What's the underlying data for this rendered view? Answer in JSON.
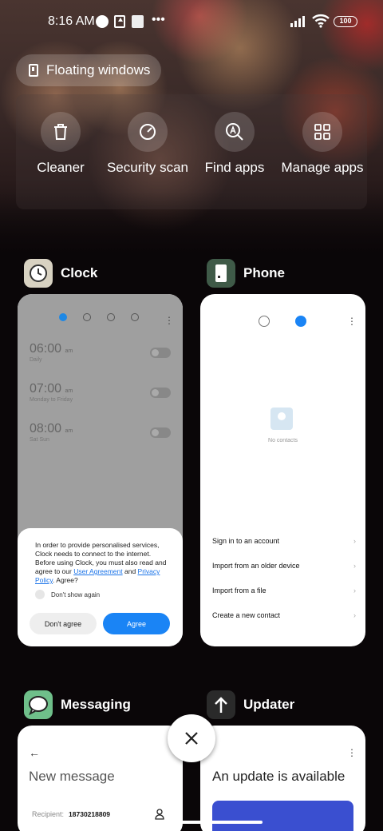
{
  "status_bar": {
    "time": "8:16 AM",
    "battery": "100"
  },
  "floating_windows": {
    "label": "Floating windows"
  },
  "quick_actions": [
    {
      "label": "Cleaner",
      "icon": "trash-icon"
    },
    {
      "label": "Security scan",
      "icon": "gauge-icon"
    },
    {
      "label": "Find apps",
      "icon": "search-apps-icon"
    },
    {
      "label": "Manage apps",
      "icon": "grid-icon"
    }
  ],
  "apps": {
    "clock": {
      "title": "Clock",
      "alarms": [
        {
          "time": "06:00",
          "suffix": "am",
          "sub": "Daily"
        },
        {
          "time": "07:00",
          "suffix": "am",
          "sub": "Monday to Friday"
        },
        {
          "time": "08:00",
          "suffix": "am",
          "sub": "Sat Sun"
        }
      ],
      "dialog": {
        "text_before": "In order to provide personalised services, Clock needs to connect to the internet. Before using Clock, you must also read and agree to our ",
        "link1": "User Agreement",
        "and": " and ",
        "link2": "Privacy Policy",
        "text_after": ". Agree?",
        "checkbox_label": "Don't show again",
        "disagree": "Don't agree",
        "agree": "Agree"
      }
    },
    "phone": {
      "title": "Phone",
      "empty_label": "No contacts",
      "rows": [
        "Sign in to an account",
        "Import from an older device",
        "Import from a file",
        "Create a new contact"
      ]
    },
    "messaging": {
      "title": "Messaging",
      "heading": "New message",
      "recipient_label": "Recipient:",
      "recipient_value": "18730218809"
    },
    "updater": {
      "title": "Updater",
      "heading": "An update is available"
    }
  },
  "colors": {
    "accent_blue": "#1a84f5",
    "card_gray": "#9f9f9f"
  }
}
